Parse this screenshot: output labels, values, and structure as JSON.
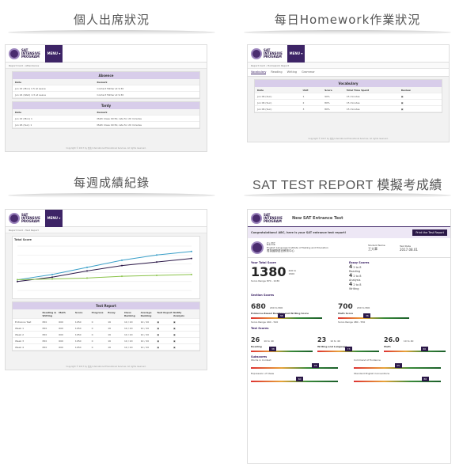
{
  "titles": {
    "tl": "個人出席狀況",
    "tr": "每日Homework作業狀況",
    "bl": "每週成績紀錄",
    "br": "SAT TEST REPORT 模擬考成績"
  },
  "brand": {
    "line1": "SAT",
    "line2": "INTENSIVE",
    "line3": "PROGRAM",
    "menu": "MENU ▾"
  },
  "attendance": {
    "crumb": "Report Card  ›  Attendance",
    "absence_title": "Absence",
    "absence_cols": [
      "Date",
      "Remark"
    ],
    "absence_rows": [
      [
        "Jun 22 (Mon) 1:5 at Leave",
        "Contact Father at 9:30"
      ],
      [
        "Jun 24 (Wed) 1:3 at Leave",
        "Contact Father at 9:30"
      ]
    ],
    "tardy_title": "Tardy",
    "tardy_cols": [
      "Date",
      "Remark"
    ],
    "tardy_rows": [
      [
        "Jun 22 (Mon) 1",
        "Math Class 09:50, late for 20 minutes"
      ],
      [
        "Jun 26 (Sun) 1",
        "Math Class 09:50, late for 20 minutes"
      ]
    ],
    "footer": "Copyright © 2017 by 菁英 International Educational Services. All rights reserved."
  },
  "homework": {
    "crumb": "Report Card  ›  Homework Report",
    "tabs": [
      "Vocabulary",
      "Reading",
      "Writing",
      "Grammar"
    ],
    "box_title": "Vocabulary",
    "cols": [
      "Date",
      "Unit",
      "Score",
      "Total Time Spent",
      "Review"
    ],
    "rows": [
      [
        "Jun 06 (Sun)",
        "1",
        "90%",
        "15 minutes"
      ],
      [
        "Jun 06 (Sun)",
        "2",
        "80%",
        "15 minutes"
      ],
      [
        "Jun 06 (Sun)",
        "3",
        "80%",
        "15 minutes"
      ]
    ],
    "footer": "Copyright © 2017 by 菁英 International Educational Services. All rights reserved."
  },
  "weekly": {
    "crumb": "Report Card  ›  Test Report",
    "chart_title": "Total Score",
    "legend": [
      "Class",
      "Me",
      "Regional"
    ],
    "table_title": "Test Report",
    "cols": [
      "",
      "Reading & Writing",
      "Math",
      "Score",
      "Progress",
      "Essay",
      "Class Ranking",
      "Average Ranking",
      "Test Report",
      "Notify Analysis"
    ],
    "rows": [
      [
        "Entrance Test",
        "650",
        "600",
        "1050",
        "0",
        "16",
        "10 / 20",
        "10 / 20"
      ],
      [
        "Week 1",
        "650",
        "600",
        "1050",
        "0",
        "16",
        "10 / 20",
        "10 / 20"
      ],
      [
        "Week 2",
        "650",
        "600",
        "1050",
        "0",
        "16",
        "10 / 20",
        "10 / 20"
      ],
      [
        "Week 3",
        "650",
        "600",
        "1050",
        "0",
        "16",
        "10 / 20",
        "10 / 20"
      ],
      [
        "Week 4",
        "650",
        "600",
        "1050",
        "0",
        "16",
        "10 / 20",
        "10 / 20"
      ]
    ],
    "footer": "Copyright © 2017 by 菁英 International Educational Services. All rights reserved."
  },
  "chart_data": {
    "type": "line",
    "title": "Total Score",
    "x": [
      "1",
      "2",
      "3",
      "4",
      "5",
      "6"
    ],
    "series": [
      {
        "name": "Class",
        "values": [
          1020,
          1080,
          1160,
          1240,
          1300,
          1340
        ]
      },
      {
        "name": "Me",
        "values": [
          1000,
          1050,
          1120,
          1180,
          1220,
          1260
        ]
      },
      {
        "name": "Regional",
        "values": [
          1020,
          1030,
          1040,
          1060,
          1070,
          1080
        ]
      }
    ],
    "ylim": [
      900,
      1400
    ],
    "colors": [
      "#3a9fc8",
      "#2b1848",
      "#8bc34a"
    ]
  },
  "sat": {
    "title": "New SAT Entrance Test",
    "banner": "Congratulations! ABC, here is your SAT entrance test report!",
    "print": "Print the Test Report",
    "school": "ELITE",
    "school_full": "English Language Institute of Testing and Education",
    "school_cn": "菁英國際語言教育中心",
    "student_label": "Student Name",
    "student": "王大華",
    "date_label": "Test Date",
    "date": "2017.08.01",
    "total_label": "Your Total Score",
    "total": "1380",
    "total_range": "400 to 1600",
    "score_range": "Score Range 870 - 1030",
    "essay_label": "Essay Scores",
    "essay": [
      [
        "4",
        "2 to 8",
        "Reading"
      ],
      [
        "4",
        "2 to 8",
        "Analysis"
      ],
      [
        "4",
        "2 to 8",
        "Writing"
      ]
    ],
    "section_label": "Section Scores",
    "ebrw": "680",
    "ebrw_range": "200 to 800",
    "ebrw_name": "Evidence-Based Reading and Writing Score",
    "ebrw_mark": "38",
    "math": "700",
    "math_range": "200 to 800",
    "math_name": "Math Score",
    "math_mark": "36",
    "sec_range1": "Score Range 440 - 520",
    "sec_range2": "Score Range 480 - 550",
    "test_label": "Test Scores",
    "tests": [
      {
        "v": "26",
        "r": "10 to 40",
        "n": "Reading",
        "m": "38"
      },
      {
        "v": "23",
        "r": "10 to 40",
        "n": "Writing and Language",
        "m": "73"
      },
      {
        "v": "26.0",
        "r": "10 to 40",
        "n": "Math",
        "m": "60"
      }
    ],
    "sub_label": "Subscores",
    "subs": [
      {
        "n": "Words in Context",
        "m": "78"
      },
      {
        "n": "Command of Evidence",
        "m": "55"
      },
      {
        "n": "Expression of Ideas",
        "m": "60"
      },
      {
        "n": "Standard English Conventions",
        "m": "86"
      }
    ]
  }
}
